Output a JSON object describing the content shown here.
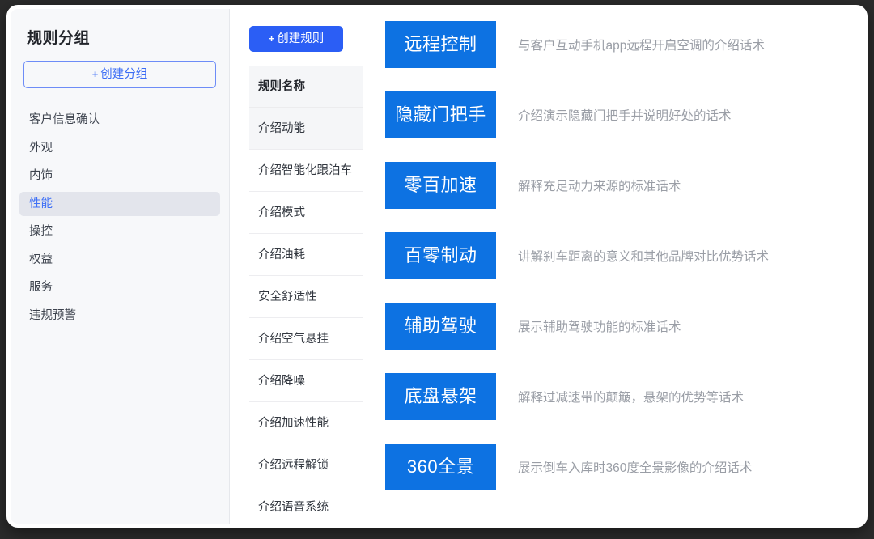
{
  "sidebar": {
    "title": "规则分组",
    "create_button": {
      "plus": "+",
      "label": "创建分组"
    },
    "items": [
      {
        "label": "客户信息确认",
        "active": false
      },
      {
        "label": "外观",
        "active": false
      },
      {
        "label": "内饰",
        "active": false
      },
      {
        "label": "性能",
        "active": true
      },
      {
        "label": "操控",
        "active": false
      },
      {
        "label": "权益",
        "active": false
      },
      {
        "label": "服务",
        "active": false
      },
      {
        "label": "违规预警",
        "active": false
      }
    ]
  },
  "rule_column": {
    "create_button": {
      "plus": "+",
      "label": "创建规则"
    },
    "header": "规则名称",
    "rows": [
      {
        "label": "介绍动能",
        "selected": true
      },
      {
        "label": "介绍智能化跟泊车",
        "selected": false
      },
      {
        "label": "介绍模式",
        "selected": false
      },
      {
        "label": "介绍油耗",
        "selected": false
      },
      {
        "label": "安全舒适性",
        "selected": false
      },
      {
        "label": "介绍空气悬挂",
        "selected": false
      },
      {
        "label": "介绍降噪",
        "selected": false
      },
      {
        "label": "介绍加速性能",
        "selected": false
      },
      {
        "label": "介绍远程解锁",
        "selected": false
      },
      {
        "label": "介绍语音系统",
        "selected": false
      }
    ]
  },
  "detail_column": {
    "rows": [
      {
        "tag": "远程控制",
        "description": "与客户互动手机app远程开启空调的介绍话术"
      },
      {
        "tag": "隐藏门把手",
        "description": "介绍演示隐藏门把手并说明好处的话术"
      },
      {
        "tag": "零百加速",
        "description": "解释充足动力来源的标准话术"
      },
      {
        "tag": "百零制动",
        "description": "讲解刹车距离的意义和其他品牌对比优势话术"
      },
      {
        "tag": "辅助驾驶",
        "description": "展示辅助驾驶功能的标准话术"
      },
      {
        "tag": "底盘悬架",
        "description": "解释过减速带的颠簸，悬架的优势等话术"
      },
      {
        "tag": "360全景",
        "description": "展示倒车入库时360度全景影像的介绍话术"
      }
    ]
  },
  "colors": {
    "primary_blue": "#2b5ef5",
    "tag_blue": "#0d72e2",
    "sidebar_bg": "#f7f8fa",
    "active_item_bg": "#e3e5ec",
    "active_item_text": "#4071f6",
    "muted_text": "#9a9ea6"
  }
}
